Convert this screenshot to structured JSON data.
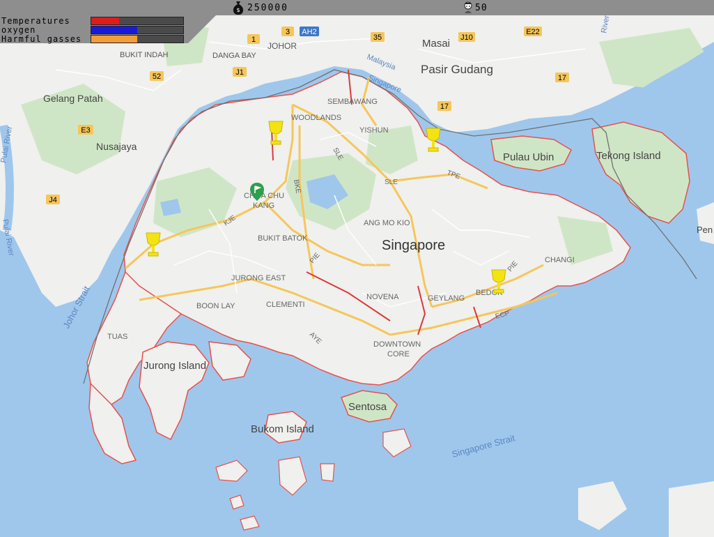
{
  "hud": {
    "stats": [
      {
        "id": "temperatures",
        "label": "Temperatures",
        "value": 0.3,
        "color": "#e01b1b"
      },
      {
        "id": "oxygen",
        "label": "oxygen",
        "value": 0.5,
        "color": "#1a1ad6"
      },
      {
        "id": "harmful",
        "label": "Harmful gasses",
        "value": 0.5,
        "color": "#f39c3c"
      }
    ],
    "money": {
      "icon": "money-bag-icon",
      "value": "250000"
    },
    "population": {
      "icon": "person-icon",
      "value": "50"
    }
  },
  "map": {
    "places": {
      "singapore": "Singapore",
      "johor": "JOHOR",
      "masai": "Masai",
      "pasir_gudang": "Pasir Gudang",
      "bukit_indah": "BUKIT INDAH",
      "danga_bay": "DANGA BAY",
      "gelang_patah": "Gelang Patah",
      "nusajaya": "Nusajaya",
      "woodlands": "WOODLANDS",
      "sembawang": "SEMBAWANG",
      "yishun": "YISHUN",
      "pulau_ubin": "Pulau Ubin",
      "tekong": "Tekong Island",
      "choa_chu_kang": "CHOA CHU",
      "choa_chu_kang2": "KANG",
      "bukit_batok": "BUKIT BATOK",
      "ang_mo_kio": "ANG MO KIO",
      "jurong_east": "JURONG EAST",
      "clementi": "CLEMENTI",
      "boon_lay": "BOON LAY",
      "novena": "NOVENA",
      "geylang": "GEYLANG",
      "bedok": "BEDOK",
      "changi": "CHANGI",
      "tuas": "TUAS",
      "jurong_island": "Jurong Island",
      "downtown": "DOWNTOWN",
      "core": "CORE",
      "sentosa": "Sentosa",
      "bukom": "Bukom Island",
      "pen": "Pen"
    },
    "water": {
      "johor_strait": "Johor Strait",
      "singapore_strait": "Singapore Strait",
      "pulai_river": "Pulai River",
      "pulai_river2": "Pulai River",
      "malaysia": "Malaysia",
      "singapore_water": "Singapore",
      "river": "River"
    },
    "roads": {
      "r1": "1",
      "r3": "3",
      "ah2": "AH2",
      "r35": "35",
      "j10": "J10",
      "e22": "E22",
      "r52": "52",
      "j1": "J1",
      "r17a": "17",
      "r17b": "17",
      "e3": "E3",
      "j4": "J4",
      "sle": "SLE",
      "sle2": "SLE",
      "tpe": "TPE",
      "bke": "BKE",
      "kje": "KJE",
      "pie": "PIE",
      "pie2": "PIE",
      "aye": "AYE",
      "ecp": "ECP"
    }
  }
}
